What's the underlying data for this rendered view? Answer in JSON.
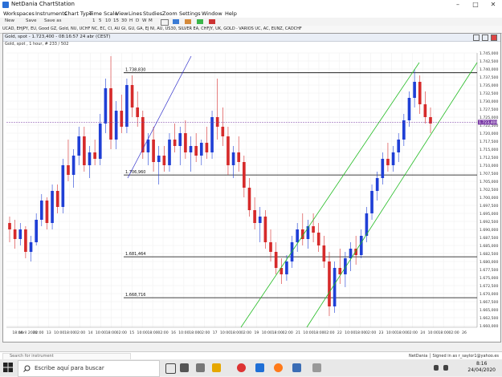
{
  "window": {
    "title": "NetDania ChartStation"
  },
  "menu": [
    "Workspaces",
    "Instruments",
    "Chart Type",
    "Time Scale",
    "View",
    "Lines",
    "Studies",
    "Zoom",
    "Settings",
    "Window",
    "Help"
  ],
  "toolbar": {
    "items": [
      "New",
      "Save",
      "Save as",
      "1",
      "5",
      "10",
      "15",
      "30",
      "H",
      "D",
      "W",
      "M"
    ]
  },
  "watchlist": {
    "text": "UCAD, EHJPY, EU, Good  GZ, Gold, NU, UCHF  NC, EC, CI, AU  GI, GU, GA, EJ  NI, AU, US30, SILVER  EA, CHFJY, UK, GOLD  ⬝ VARIOS  UC, AC, EUNZ, CADCHF"
  },
  "chart_window": {
    "title": "Gold, spot - 1.723,400 - 08:16:57  24 abr (CEST)",
    "subtitle": "Gold, spot , 1 hour, # 233 / 502"
  },
  "chart_data": {
    "type": "candlestick",
    "instrument": "Gold, spot",
    "timeframe": "1 hour",
    "ylim": [
      1858,
      1746
    ],
    "y_ticks": [
      "1.745,000",
      "1.742,500",
      "1.740,000",
      "1.737,500",
      "1.735,000",
      "1.732,500",
      "1.730,000",
      "1.727,500",
      "1.725,000",
      "1.722,500",
      "1.720,000",
      "1.717,500",
      "1.715,000",
      "1.712,500",
      "1.710,000",
      "1.707,500",
      "1.705,000",
      "1.702,500",
      "1.700,000",
      "1.697,500",
      "1.695,000",
      "1.692,500",
      "1.690,000",
      "1.687,500",
      "1.685,000",
      "1.682,500",
      "1.680,000",
      "1.677,500",
      "1.675,000",
      "1.672,500",
      "1.670,000",
      "1.667,500",
      "1.665,000",
      "1.662,500",
      "1.660,000"
    ],
    "current_price": "1.723,400",
    "horizontal_levels": [
      {
        "label": "1.738,830",
        "value": 1738.83
      },
      {
        "label": "1.706,960",
        "value": 1706.96
      },
      {
        "label": "1.681,464",
        "value": 1681.464
      },
      {
        "label": "1.668,716",
        "value": 1668.716
      }
    ],
    "x_tick_labels": [
      "18:00",
      "abril 2020",
      "02:00",
      "13",
      "10:00",
      "18:00",
      "02:00",
      "14",
      "10:00",
      "18:00",
      "02:00",
      "15",
      "10:00",
      "18:00",
      "02:00",
      "16",
      "10:00",
      "18:00",
      "02:00",
      "17",
      "10:00",
      "18:00",
      "02:00",
      "19",
      "10:00",
      "18:00",
      "02:00",
      "21",
      "10:00",
      "18:00",
      "02:00",
      "22",
      "10:00",
      "18:00",
      "02:00",
      "23",
      "10:00",
      "18:00",
      "02:00",
      "24",
      "10:00",
      "18:00",
      "02:00",
      "26"
    ],
    "candles": [
      [
        1692,
        1694,
        1686,
        1690
      ],
      [
        1690,
        1693,
        1684,
        1687
      ],
      [
        1687,
        1692,
        1685,
        1690
      ],
      [
        1690,
        1691,
        1681,
        1683
      ],
      [
        1683,
        1688,
        1680,
        1686
      ],
      [
        1686,
        1695,
        1685,
        1693
      ],
      [
        1693,
        1701,
        1691,
        1699
      ],
      [
        1699,
        1700,
        1690,
        1692
      ],
      [
        1692,
        1704,
        1690,
        1702
      ],
      [
        1702,
        1704,
        1695,
        1697
      ],
      [
        1697,
        1712,
        1695,
        1710
      ],
      [
        1710,
        1718,
        1705,
        1707
      ],
      [
        1707,
        1715,
        1703,
        1713
      ],
      [
        1713,
        1722,
        1710,
        1719
      ],
      [
        1719,
        1722,
        1708,
        1710
      ],
      [
        1710,
        1716,
        1706,
        1714
      ],
      [
        1714,
        1718,
        1710,
        1712
      ],
      [
        1712,
        1726,
        1710,
        1723
      ],
      [
        1723,
        1737,
        1720,
        1734
      ],
      [
        1734,
        1744,
        1715,
        1718
      ],
      [
        1718,
        1730,
        1715,
        1727
      ],
      [
        1727,
        1732,
        1720,
        1722
      ],
      [
        1722,
        1737,
        1720,
        1735
      ],
      [
        1735,
        1738,
        1725,
        1728
      ],
      [
        1728,
        1733,
        1722,
        1725
      ],
      [
        1725,
        1727,
        1712,
        1714
      ],
      [
        1714,
        1720,
        1710,
        1718
      ],
      [
        1718,
        1722,
        1708,
        1711
      ],
      [
        1711,
        1716,
        1704,
        1713
      ],
      [
        1713,
        1716,
        1708,
        1710
      ],
      [
        1710,
        1720,
        1708,
        1718
      ],
      [
        1718,
        1723,
        1714,
        1716
      ],
      [
        1716,
        1722,
        1710,
        1720
      ],
      [
        1720,
        1724,
        1712,
        1714
      ],
      [
        1714,
        1719,
        1708,
        1716
      ],
      [
        1716,
        1720,
        1711,
        1713
      ],
      [
        1713,
        1718,
        1710,
        1717
      ],
      [
        1717,
        1722,
        1712,
        1714
      ],
      [
        1714,
        1727,
        1712,
        1725
      ],
      [
        1725,
        1737,
        1718,
        1722
      ],
      [
        1722,
        1728,
        1716,
        1719
      ],
      [
        1719,
        1722,
        1707,
        1710
      ],
      [
        1710,
        1716,
        1706,
        1714
      ],
      [
        1714,
        1719,
        1708,
        1711
      ],
      [
        1711,
        1713,
        1700,
        1703
      ],
      [
        1703,
        1706,
        1694,
        1696
      ],
      [
        1696,
        1700,
        1690,
        1692
      ],
      [
        1692,
        1697,
        1686,
        1694
      ],
      [
        1694,
        1696,
        1684,
        1686
      ],
      [
        1686,
        1690,
        1680,
        1683
      ],
      [
        1683,
        1686,
        1676,
        1678
      ],
      [
        1678,
        1681,
        1673,
        1676
      ],
      [
        1676,
        1682,
        1674,
        1680
      ],
      [
        1680,
        1688,
        1678,
        1686
      ],
      [
        1686,
        1692,
        1683,
        1690
      ],
      [
        1690,
        1695,
        1685,
        1687
      ],
      [
        1687,
        1693,
        1684,
        1691
      ],
      [
        1691,
        1695,
        1686,
        1689
      ],
      [
        1689,
        1692,
        1683,
        1685
      ],
      [
        1685,
        1688,
        1678,
        1680
      ],
      [
        1680,
        1683,
        1663,
        1666
      ],
      [
        1666,
        1680,
        1664,
        1678
      ],
      [
        1678,
        1684,
        1673,
        1676
      ],
      [
        1676,
        1683,
        1672,
        1681
      ],
      [
        1681,
        1686,
        1677,
        1684
      ],
      [
        1684,
        1688,
        1679,
        1682
      ],
      [
        1682,
        1690,
        1681,
        1688
      ],
      [
        1688,
        1697,
        1686,
        1695
      ],
      [
        1695,
        1704,
        1693,
        1702
      ],
      [
        1702,
        1708,
        1699,
        1706
      ],
      [
        1706,
        1714,
        1704,
        1712
      ],
      [
        1712,
        1717,
        1708,
        1710
      ],
      [
        1710,
        1716,
        1708,
        1714
      ],
      [
        1714,
        1720,
        1711,
        1718
      ],
      [
        1718,
        1726,
        1716,
        1724
      ],
      [
        1724,
        1733,
        1722,
        1731
      ],
      [
        1731,
        1740,
        1728,
        1736
      ],
      [
        1736,
        1738,
        1726,
        1729
      ],
      [
        1729,
        1733,
        1723,
        1725
      ],
      [
        1725,
        1728,
        1720,
        1723
      ]
    ]
  },
  "bottom": {
    "search_placeholder": "Search for instrument",
    "status": "NetDania  │  Signed in as r_saylor1@yahoo.es"
  },
  "taskbar": {
    "search_text": "Escribe aquí para buscar",
    "time": "8:16",
    "date": "24/04/2020"
  },
  "colors": {
    "bull": "#1f3fd6",
    "bear": "#d62a2a",
    "channel": "#22bb22",
    "trendline": "#3333cc",
    "level": "#000000",
    "price_line": "#7a3aa6"
  }
}
